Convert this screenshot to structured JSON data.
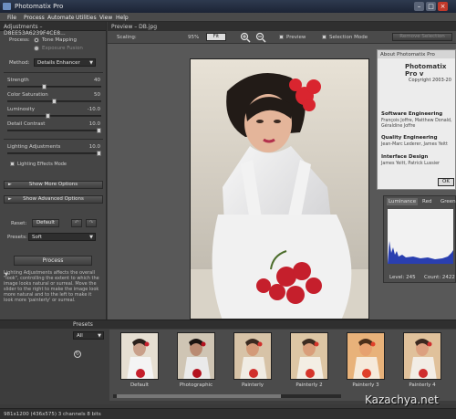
{
  "window": {
    "title": "Photomatix Pro",
    "min": "–",
    "max": "□",
    "close": "×"
  },
  "menu": [
    "File",
    "Process",
    "Automate",
    "Utilities",
    "View",
    "Help"
  ],
  "adjustments": {
    "header": "Adjustments – D8EE53A6239F4CE8...",
    "process_label": "Process:",
    "process_options": [
      "Tone Mapping",
      "Exposure Fusion"
    ],
    "process_selected": "Tone Mapping",
    "method_label": "Method:",
    "method_value": "Details Enhancer",
    "sliders": [
      {
        "label": "Strength",
        "value": "40",
        "level": 0.4
      },
      {
        "label": "Color Saturation",
        "value": "50",
        "level": 0.5
      },
      {
        "label": "Luminosity",
        "value": "-10.0",
        "level": 0.43
      },
      {
        "label": "Detail Contrast",
        "value": "10.0",
        "level": 1.0
      },
      {
        "label": "Lighting Adjustments",
        "value": "10.0",
        "level": 1.0
      }
    ],
    "lighting_mode": "Lighting Effects Mode",
    "show_more": "Show More Options",
    "show_advanced": "Show Advanced Options",
    "reset_label": "Reset:",
    "default_btn": "Default",
    "presets_label": "Presets:",
    "presets_value": "Soft",
    "process_btn": "Process",
    "help": "Lighting Adjustments affects the overall \"look\", controlling the extent to which the image looks natural or surreal. Move the slider to the right to make the image look more natural and to the left to make it look more 'painterly' or surreal."
  },
  "preview": {
    "header": "Preview – DB.jpg",
    "scaling_label": "Scaling:",
    "zoom": "95%",
    "fit_btn": "Fit",
    "preview_label": "Preview",
    "selection_mode": "Selection Mode",
    "remove_selection": "Remove Selection"
  },
  "about": {
    "header": "About Photomatix Pro",
    "product": "Photomatix Pro v",
    "copyright": "Copyright 2003-20",
    "sections": [
      {
        "title": "Software Engineering",
        "names": "François Joffre, Matthew Donald, Géraldine Joffre"
      },
      {
        "title": "Quality Engineering",
        "names": "Jean-Marc Lederer, James Yeitt"
      },
      {
        "title": "Interface Design",
        "names": "James Yeitt, Patrick Lussier"
      }
    ],
    "ok": "OK"
  },
  "histogram": {
    "tabs": [
      "Luminance",
      "Red",
      "Green"
    ],
    "level_label": "Level: 245",
    "count_label": "Count: 2422"
  },
  "presets_panel": {
    "header": "Presets",
    "filter": "All",
    "items": [
      "Default",
      "Photographic",
      "Painterly",
      "Painterly 2",
      "Painterly 3",
      "Painterly 4"
    ]
  },
  "status": "981x1200 (436x575) 3 channels 8 bits",
  "watermark": "Kazachya.net"
}
